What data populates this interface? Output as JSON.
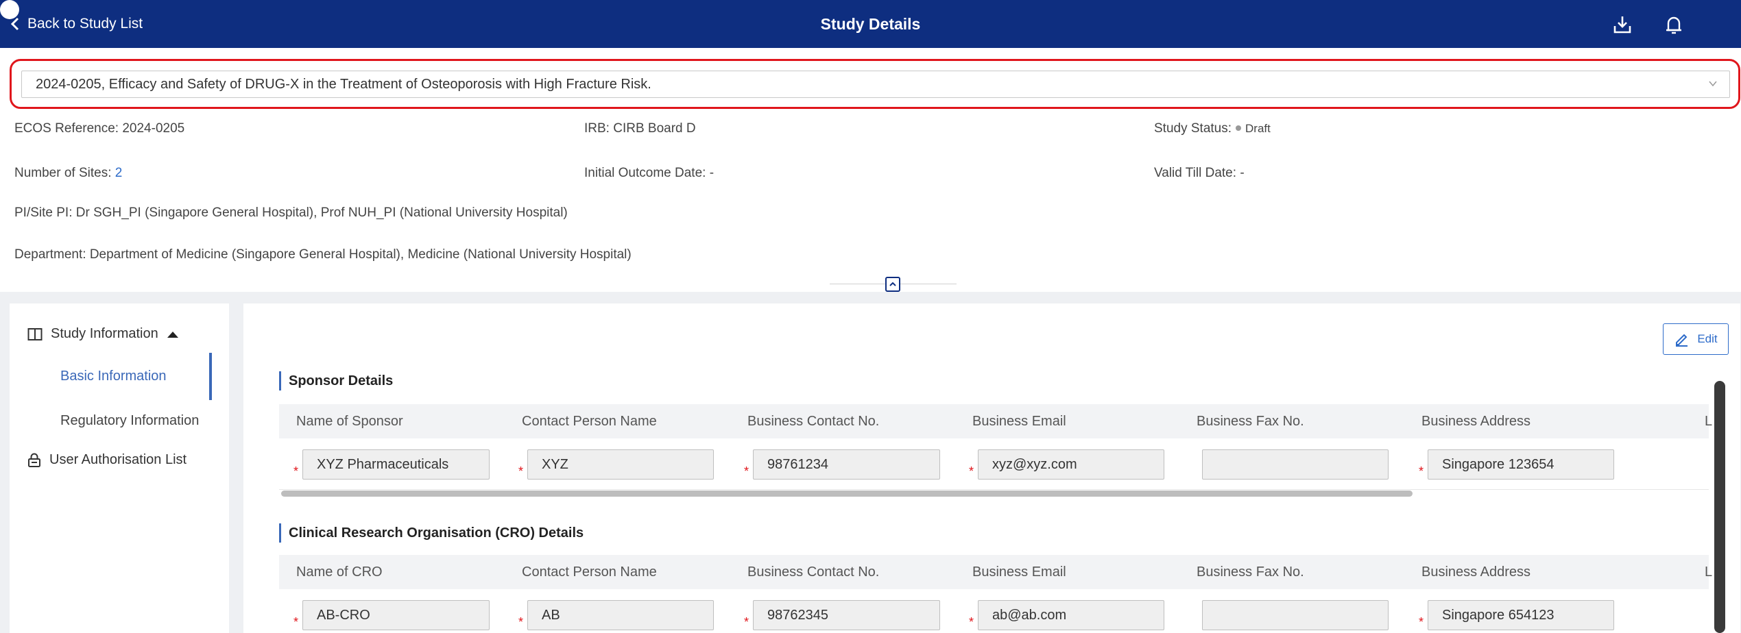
{
  "header": {
    "back_label": "Back to Study List",
    "title": "Study Details",
    "icons": [
      "download-icon",
      "bell-icon",
      "avatar"
    ]
  },
  "study_selector": {
    "value": "2024-0205, Efficacy and Safety of DRUG-X in the Treatment of Osteoporosis with High Fracture Risk."
  },
  "summary": {
    "ecos_label": "ECOS Reference:",
    "ecos_value": "2024-0205",
    "irb_label": "IRB:",
    "irb_value": "CIRB Board D",
    "status_label": "Study Status:",
    "status_value": "Draft",
    "sites_label": "Number of Sites:",
    "sites_value": "2",
    "initial_label": "Initial Outcome Date:",
    "initial_value": "-",
    "valid_label": "Valid Till Date:",
    "valid_value": "-",
    "pi_label": "PI/Site PI:",
    "pi_value": "Dr SGH_PI (Singapore General Hospital), Prof NUH_PI (National University Hospital)",
    "dept_label": "Department:",
    "dept_value": "Department of Medicine (Singapore General Hospital), Medicine (National University Hospital)"
  },
  "sidebar": {
    "study_info": "Study Information",
    "basic_info": "Basic Information",
    "regulatory_info": "Regulatory Information",
    "user_auth": "User Authorisation List"
  },
  "edit_label": "Edit",
  "sponsor": {
    "title": "Sponsor Details",
    "columns": [
      "Name of Sponsor",
      "Contact Person Name",
      "Business Contact No.",
      "Business Email",
      "Business Fax No.",
      "Business Address",
      "L"
    ],
    "values": [
      "XYZ Pharmaceuticals",
      "XYZ",
      "98761234",
      "xyz@xyz.com",
      "",
      "Singapore 123654"
    ]
  },
  "cro": {
    "title": "Clinical Research Organisation (CRO) Details",
    "columns": [
      "Name of CRO",
      "Contact Person Name",
      "Business Contact No.",
      "Business Email",
      "Business Fax No.",
      "Business Address",
      "L"
    ],
    "values": [
      "AB-CRO",
      "AB",
      "98762345",
      "ab@ab.com",
      "",
      "Singapore 654123"
    ]
  },
  "colors": {
    "header_bg": "#0e2e80",
    "highlight_border": "#e0161c",
    "accent": "#3a68b8",
    "required": "#e0161c"
  }
}
